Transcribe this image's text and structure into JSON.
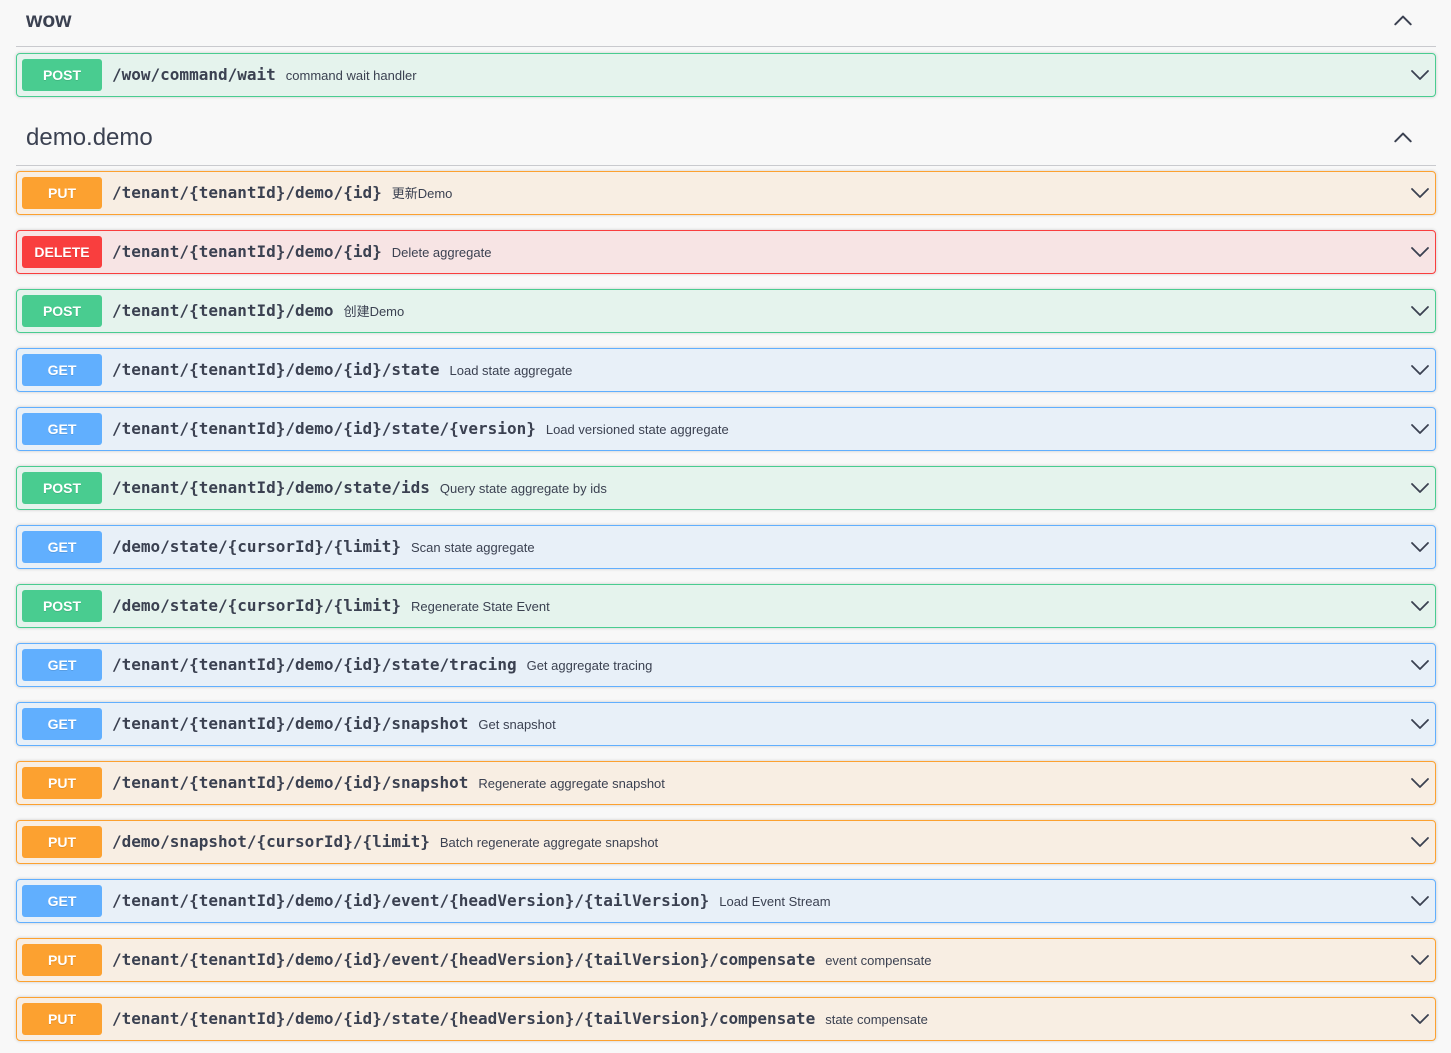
{
  "sections": [
    {
      "title": "wow",
      "operations": [
        {
          "method": "POST",
          "path": "/wow/command/wait",
          "description": "command wait handler"
        }
      ]
    },
    {
      "title": "demo.demo",
      "operations": [
        {
          "method": "PUT",
          "path": "/tenant/{tenantId}/demo/{id}",
          "description": "更新Demo"
        },
        {
          "method": "DELETE",
          "path": "/tenant/{tenantId}/demo/{id}",
          "description": "Delete aggregate"
        },
        {
          "method": "POST",
          "path": "/tenant/{tenantId}/demo",
          "description": "创建Demo"
        },
        {
          "method": "GET",
          "path": "/tenant/{tenantId}/demo/{id}/state",
          "description": "Load state aggregate"
        },
        {
          "method": "GET",
          "path": "/tenant/{tenantId}/demo/{id}/state/{version}",
          "description": "Load versioned state aggregate"
        },
        {
          "method": "POST",
          "path": "/tenant/{tenantId}/demo/state/ids",
          "description": "Query state aggregate by ids"
        },
        {
          "method": "GET",
          "path": "/demo/state/{cursorId}/{limit}",
          "description": "Scan state aggregate"
        },
        {
          "method": "POST",
          "path": "/demo/state/{cursorId}/{limit}",
          "description": "Regenerate State Event"
        },
        {
          "method": "GET",
          "path": "/tenant/{tenantId}/demo/{id}/state/tracing",
          "description": "Get aggregate tracing"
        },
        {
          "method": "GET",
          "path": "/tenant/{tenantId}/demo/{id}/snapshot",
          "description": "Get snapshot"
        },
        {
          "method": "PUT",
          "path": "/tenant/{tenantId}/demo/{id}/snapshot",
          "description": "Regenerate aggregate snapshot"
        },
        {
          "method": "PUT",
          "path": "/demo/snapshot/{cursorId}/{limit}",
          "description": "Batch regenerate aggregate snapshot"
        },
        {
          "method": "GET",
          "path": "/tenant/{tenantId}/demo/{id}/event/{headVersion}/{tailVersion}",
          "description": "Load Event Stream"
        },
        {
          "method": "PUT",
          "path": "/tenant/{tenantId}/demo/{id}/event/{headVersion}/{tailVersion}/compensate",
          "description": "event compensate"
        },
        {
          "method": "PUT",
          "path": "/tenant/{tenantId}/demo/{id}/state/{headVersion}/{tailVersion}/compensate",
          "description": "state compensate"
        }
      ]
    }
  ],
  "icons": {
    "collapse": "chevron-up-icon",
    "expand": "chevron-down-icon"
  },
  "colors": {
    "POST": "#49cc90",
    "PUT": "#fca130",
    "DELETE": "#f93e3e",
    "GET": "#61affe"
  }
}
